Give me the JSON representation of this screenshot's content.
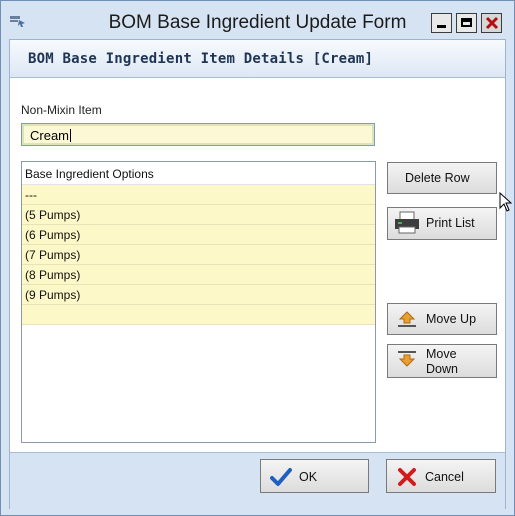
{
  "window": {
    "title": "BOM Base Ingredient Update Form"
  },
  "header": {
    "title": "BOM Base Ingredient Item Details [Cream]"
  },
  "form": {
    "field_label": "Non-Mixin Item",
    "field_value": "Cream"
  },
  "grid": {
    "column_header": "Base Ingredient Options",
    "rows": [
      "---",
      "(5 Pumps)",
      "(6 Pumps)",
      "(7 Pumps)",
      "(8 Pumps)",
      "(9 Pumps)",
      ""
    ]
  },
  "buttons": {
    "delete_row": "Delete Row",
    "print_list": "Print List",
    "move_up": "Move Up",
    "move_down_line1": "Move",
    "move_down_line2": "Down",
    "ok": "OK",
    "cancel": "Cancel"
  },
  "icons": {
    "app": "form-icon",
    "print": "printer-icon",
    "move_up": "arrow-up-icon",
    "move_down": "arrow-down-icon",
    "ok": "checkmark-icon",
    "cancel": "x-icon",
    "cursor": "move-cursor-icon"
  },
  "colors": {
    "input_background": "#fcf8d5",
    "row_background": "#fcf8c8",
    "chrome": "#d6e3f2",
    "ok_check": "#1f5fbf",
    "cancel_x": "#d21c1c",
    "arrow": "#e8a030"
  }
}
